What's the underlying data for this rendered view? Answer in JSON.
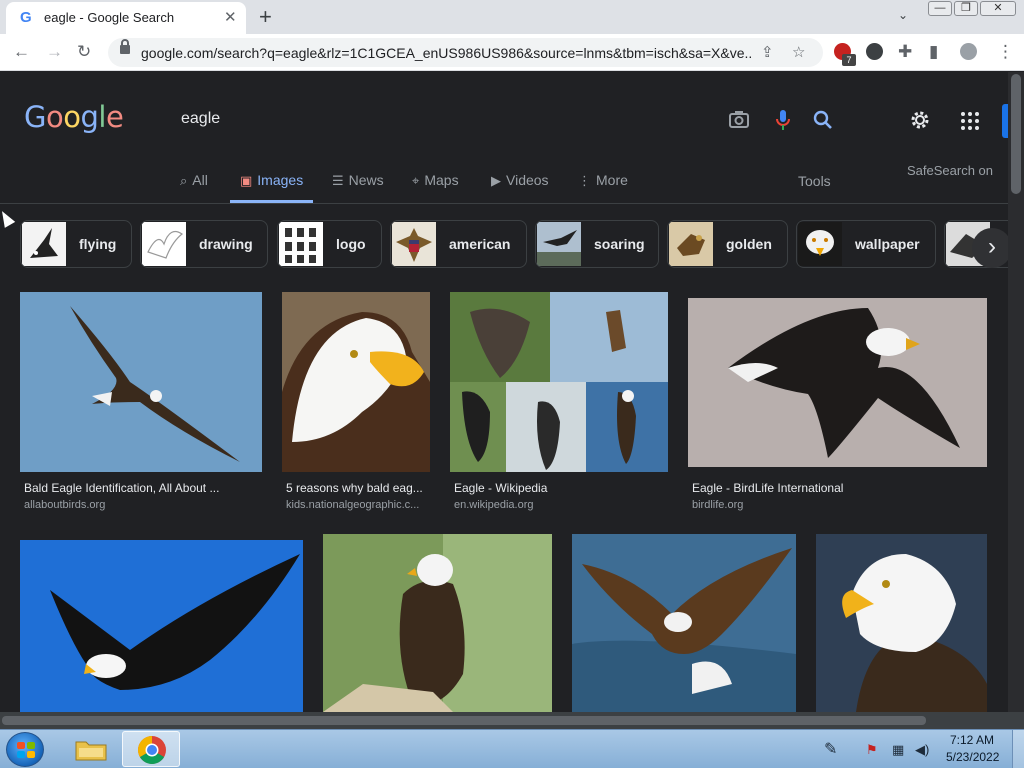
{
  "browser": {
    "tab_title": "eagle - Google Search",
    "tab_favicon": "G",
    "close_glyph": "✕",
    "new_tab_glyph": "+",
    "tab_search_glyph": "⌄",
    "url": "google.com/search?q=eagle&rlz=1C1GCEA_enUS986US986&source=lnms&tbm=isch&sa=X&ve...",
    "extension_badge": "7",
    "window_buttons": [
      "—",
      "❐",
      "✕"
    ]
  },
  "header": {
    "logo": [
      "G",
      "o",
      "o",
      "g",
      "l",
      "e"
    ],
    "query": "eagle",
    "safesearch": "SafeSearch on",
    "tools": "Tools",
    "tabs": [
      {
        "label": "All",
        "icon": "⌕"
      },
      {
        "label": "Images",
        "icon": "▣"
      },
      {
        "label": "News",
        "icon": "☰"
      },
      {
        "label": "Maps",
        "icon": "⌖"
      },
      {
        "label": "Videos",
        "icon": "▶"
      },
      {
        "label": "More",
        "icon": "⋮"
      }
    ]
  },
  "chips": [
    {
      "label": "flying"
    },
    {
      "label": "drawing"
    },
    {
      "label": "logo"
    },
    {
      "label": "american"
    },
    {
      "label": "soaring"
    },
    {
      "label": "golden"
    },
    {
      "label": "wallpaper"
    },
    {
      "label": ""
    }
  ],
  "results": [
    {
      "title": "Bald Eagle Identification, All About ...",
      "source": "allaboutbirds.org"
    },
    {
      "title": "5 reasons why bald eag...",
      "source": "kids.nationalgeographic.c..."
    },
    {
      "title": "Eagle - Wikipedia",
      "source": "en.wikipedia.org"
    },
    {
      "title": "Eagle - BirdLife International",
      "source": "birdlife.org"
    },
    {
      "title": "",
      "source": ""
    },
    {
      "title": "",
      "source": ""
    },
    {
      "title": "",
      "source": ""
    },
    {
      "title": "",
      "source": ""
    }
  ],
  "taskbar": {
    "time": "7:12 AM",
    "date": "5/23/2022"
  },
  "colors": {
    "page_bg": "#202124",
    "accent": "#8ab4f8",
    "text": "#e8eaed",
    "muted": "#9aa0a6"
  }
}
